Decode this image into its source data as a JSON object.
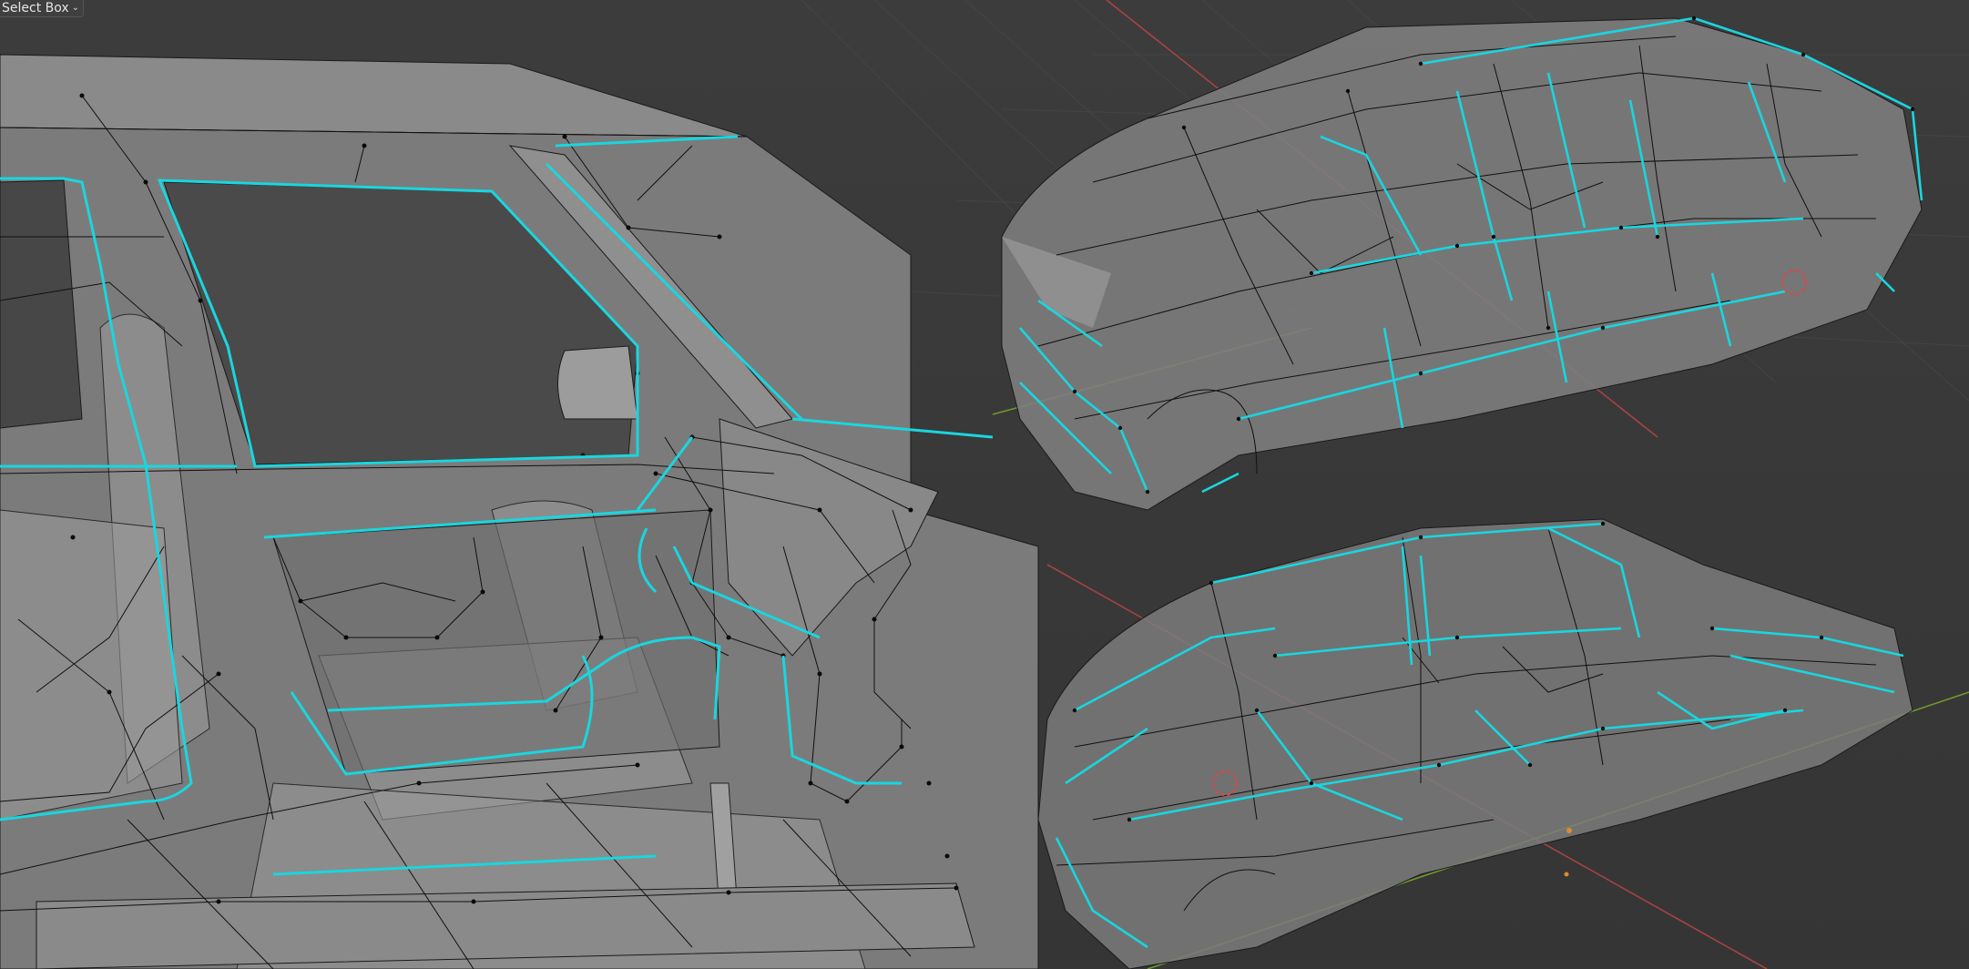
{
  "toolbar": {
    "select_mode_label": "Select Box",
    "select_mode_icon": "chevron-down-icon"
  },
  "viewport": {
    "background": "#3a3a3a",
    "mesh_color": "#8e8e8e",
    "wire_color": "#111111",
    "selected_edge_color": "#19d6df",
    "x_axis_color": "#b04545",
    "y_axis_color": "#6f9a2b",
    "cursor_color": "#e04545"
  }
}
